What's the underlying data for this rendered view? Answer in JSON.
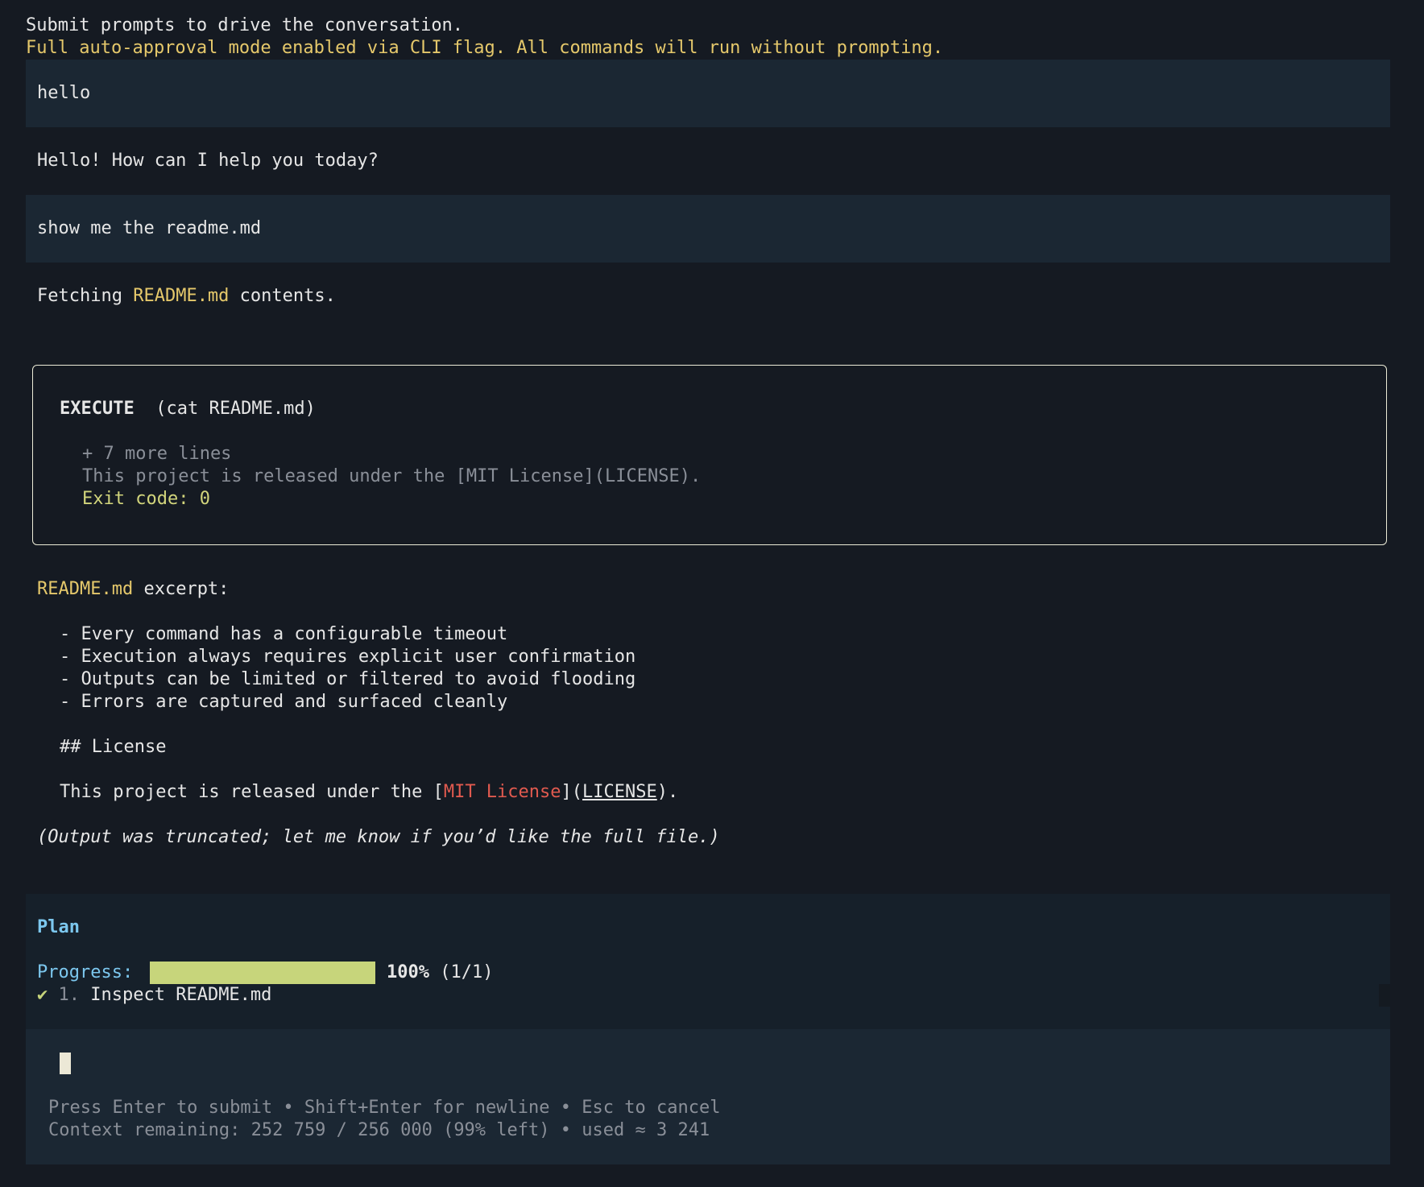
{
  "header": {
    "intro": "Submit prompts to drive the conversation.",
    "warning": "Full auto-approval mode enabled via CLI flag. All commands will run without prompting."
  },
  "messages": {
    "user1": "hello",
    "assistant1": "Hello! How can I help you today?",
    "user2": "show me the readme.md",
    "fetching_prefix": "Fetching ",
    "fetching_file": "README.md",
    "fetching_suffix": " contents."
  },
  "execute": {
    "label": "EXECUTE",
    "command": "(cat README.md)",
    "more_lines": "+ 7 more lines",
    "last_line": "This project is released under the [MIT License](LICENSE).",
    "exit_code": "Exit code: 0"
  },
  "excerpt": {
    "file": "README.md",
    "suffix": " excerpt:",
    "bullets": [
      "- Every command has a configurable timeout",
      "- Execution always requires explicit user confirmation",
      "- Outputs can be limited or filtered to avoid flooding",
      "- Errors are captured and surfaced cleanly"
    ],
    "license_heading": "## License",
    "license_prefix": "This project is released under the [",
    "license_link_text": "MIT License",
    "license_mid": "](",
    "license_target": "LICENSE",
    "license_end": ").",
    "note": "(Output was truncated; let me know if you’d like the full file.)"
  },
  "plan": {
    "title": "Plan",
    "progress_label": "Progress:",
    "progress_fraction": 1.0,
    "progress_percent": "100%",
    "progress_count": "(1/1)",
    "items": [
      {
        "check": "✔",
        "number": "1.",
        "text": "Inspect README.md"
      }
    ]
  },
  "input": {
    "hint": "Press Enter to submit • Shift+Enter for newline • Esc to cancel",
    "context": "Context remaining: 252 759 / 256 000 (99% left) • used ≈ 3 241"
  },
  "colors": {
    "background": "#151a22",
    "user_block": "#1b2733",
    "accent_yellow": "#e5c86b",
    "plan_blue": "#7cc7ee",
    "progress_fill": "#c7d57b",
    "link_red": "#e15a4f"
  }
}
